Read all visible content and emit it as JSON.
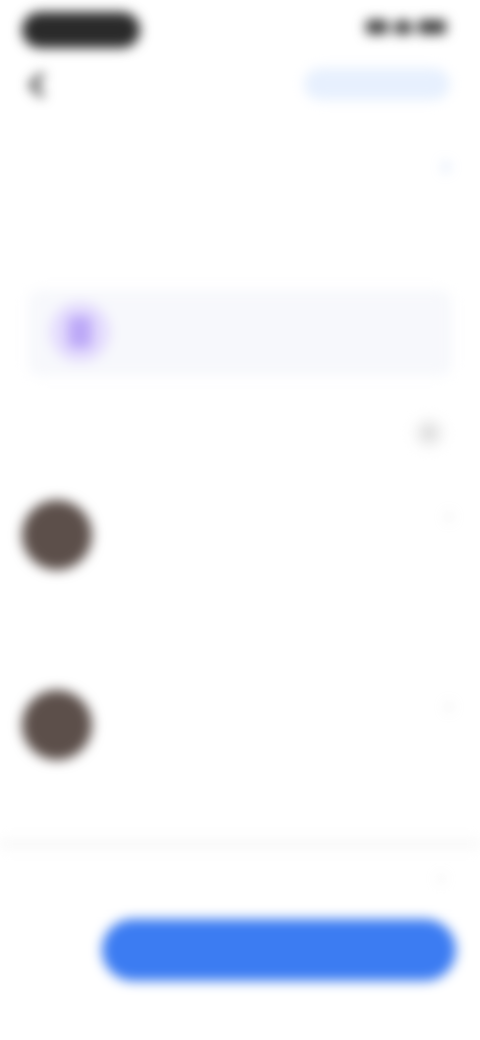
{
  "status_bar": {
    "time": ""
  },
  "header": {
    "action_label": "",
    "condition_link": "",
    "condition_text": ""
  },
  "stats": [
    {
      "value": "",
      "label": ""
    },
    {
      "value": "",
      "label": ""
    }
  ],
  "banner": {
    "title": "",
    "subtitle": ""
  },
  "section": {
    "title": ""
  },
  "cards": [
    {
      "name": "",
      "meta": "",
      "tag": ""
    },
    {
      "name": "",
      "meta": "",
      "tag": ""
    }
  ],
  "footer": {
    "label": "",
    "side_label": "",
    "primary_button": ""
  },
  "colors": {
    "accent": "#3c7cf2",
    "banner_icon": "#bca8f7",
    "avatar": "#5c4f4a"
  },
  "icons": [
    "back-arrow-icon",
    "chevron-right-icon",
    "document-icon",
    "more-icon",
    "signal-icon",
    "wifi-icon",
    "battery-icon"
  ]
}
